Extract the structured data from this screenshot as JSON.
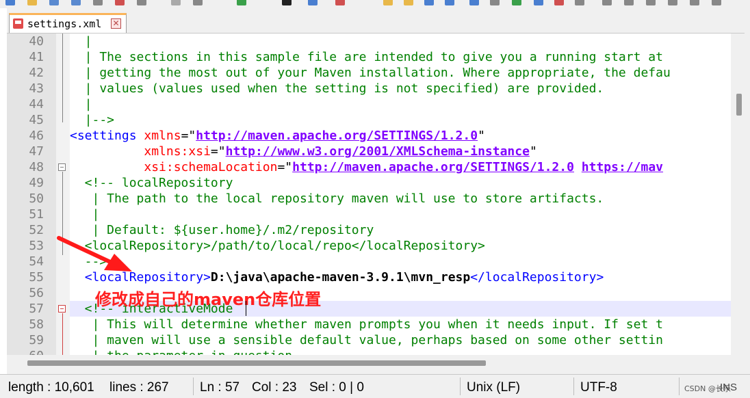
{
  "tab": {
    "filename": "settings.xml",
    "close": "✕"
  },
  "annotation": "修改成自己的maven仓库位置",
  "lines": [
    {
      "n": "40",
      "tokens": [
        [
          "c-comment",
          "  |"
        ]
      ]
    },
    {
      "n": "41",
      "tokens": [
        [
          "c-comment",
          "  | The sections in this sample file are intended to give you a running start at"
        ]
      ]
    },
    {
      "n": "42",
      "tokens": [
        [
          "c-comment",
          "  | getting the most out of your Maven installation. Where appropriate, the defau"
        ]
      ]
    },
    {
      "n": "43",
      "tokens": [
        [
          "c-comment",
          "  | values (values used when the setting is not specified) are provided."
        ]
      ]
    },
    {
      "n": "44",
      "tokens": [
        [
          "c-comment",
          "  |"
        ]
      ]
    },
    {
      "n": "45",
      "tokens": [
        [
          "c-comment",
          "  |-->"
        ]
      ]
    },
    {
      "n": "46",
      "tokens": [
        [
          "c-tag",
          "<settings "
        ],
        [
          "c-attr",
          "xmlns"
        ],
        [
          "c-punct",
          "=\""
        ],
        [
          "c-val",
          "http://maven.apache.org/SETTINGS/1.2.0"
        ],
        [
          "c-punct",
          "\""
        ]
      ]
    },
    {
      "n": "47",
      "tokens": [
        [
          "c-punct",
          "          "
        ],
        [
          "c-attr",
          "xmlns:xsi"
        ],
        [
          "c-punct",
          "=\""
        ],
        [
          "c-val",
          "http://www.w3.org/2001/XMLSchema-instance"
        ],
        [
          "c-punct",
          "\""
        ]
      ]
    },
    {
      "n": "48",
      "tokens": [
        [
          "c-punct",
          "          "
        ],
        [
          "c-attr",
          "xsi:schemaLocation"
        ],
        [
          "c-punct",
          "=\""
        ],
        [
          "c-val",
          "http://maven.apache.org/SETTINGS/1.2.0"
        ],
        [
          "c-punct",
          " "
        ],
        [
          "c-val",
          "https://mav"
        ]
      ]
    },
    {
      "n": "49",
      "tokens": [
        [
          "c-comment",
          "  <!-- localRepository"
        ]
      ]
    },
    {
      "n": "50",
      "tokens": [
        [
          "c-comment",
          "   | The path to the local repository maven will use to store artifacts."
        ]
      ]
    },
    {
      "n": "51",
      "tokens": [
        [
          "c-comment",
          "   |"
        ]
      ]
    },
    {
      "n": "52",
      "tokens": [
        [
          "c-comment",
          "   | Default: ${user.home}/.m2/repository"
        ]
      ]
    },
    {
      "n": "53",
      "tokens": [
        [
          "c-comment",
          "  <localRepository>/path/to/local/repo</localRepository>"
        ]
      ]
    },
    {
      "n": "54",
      "tokens": [
        [
          "c-comment",
          "  -->"
        ]
      ]
    },
    {
      "n": "55",
      "tokens": [
        [
          "c-punct",
          "  "
        ],
        [
          "c-tag",
          "<localRepository>"
        ],
        [
          "c-text",
          "D:\\java\\apache-maven-3.9.1\\mvn_resp"
        ],
        [
          "c-tag",
          "</localRepository>"
        ]
      ]
    },
    {
      "n": "56",
      "tokens": [
        [
          "c-punct",
          ""
        ]
      ]
    },
    {
      "n": "57",
      "tokens": [
        [
          "c-comment",
          "  <!-- interactiveMode"
        ]
      ],
      "current": true
    },
    {
      "n": "58",
      "tokens": [
        [
          "c-comment",
          "   | This will determine whether maven prompts you when it needs input. If set t"
        ]
      ]
    },
    {
      "n": "59",
      "tokens": [
        [
          "c-comment",
          "   | maven will use a sensible default value, perhaps based on some other settin"
        ]
      ]
    },
    {
      "n": "60",
      "tokens": [
        [
          "c-comment",
          "   | the parameter in question."
        ]
      ]
    }
  ],
  "status": {
    "length": "length : 10,601",
    "lines": "lines : 267",
    "ln": "Ln : 57",
    "col": "Col : 23",
    "sel": "Sel : 0 | 0",
    "eol": "Unix (LF)",
    "encoding": "UTF-8",
    "watermark": "CSDN @长乐",
    "mode": "INS"
  },
  "colors": {
    "annotation": "#ff2020",
    "arrow": "#ff1a1a",
    "current_line": "#e8e8ff"
  }
}
